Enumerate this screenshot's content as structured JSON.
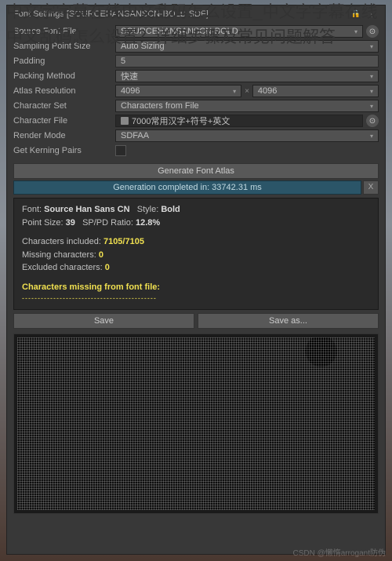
{
  "overlay": {
    "title": "中文字字幕在线中文乱码怎么设置_中文字字幕在线中文乱码怎么设置？详细步骤及常见问题解答"
  },
  "panel": {
    "title": "Font Settings [SOURCEHANSANSCN-BOLD SDF]"
  },
  "fields": {
    "sourceFontFile": {
      "label": "Source Font File",
      "value": "SOURCEHANSANSCN-BOLD"
    },
    "samplingPointSize": {
      "label": "Sampling Point Size",
      "value": "Auto Sizing"
    },
    "padding": {
      "label": "Padding",
      "value": "5"
    },
    "packingMethod": {
      "label": "Packing Method",
      "value": "快速"
    },
    "atlasResolution": {
      "label": "Atlas Resolution",
      "w": "4096",
      "h": "4096"
    },
    "characterSet": {
      "label": "Character Set",
      "value": "Characters from File"
    },
    "characterFile": {
      "label": "Character File",
      "value": "7000常用汉字+符号+英文"
    },
    "renderMode": {
      "label": "Render Mode",
      "value": "SDFAA"
    },
    "getKerningPairs": {
      "label": "Get Kerning Pairs"
    }
  },
  "buttons": {
    "generate": "Generate Font Atlas",
    "save": "Save",
    "saveAs": "Save as...",
    "close": "X"
  },
  "status": {
    "message": "Generation completed in: 33742.31 ms"
  },
  "info": {
    "fontLabel": "Font:",
    "fontName": "Source Han Sans CN",
    "styleLabel": "Style:",
    "styleName": "Bold",
    "pointSize": "Point Size:",
    "pointSizeVal": "39",
    "spRatio": "SP/PD Ratio:",
    "spRatioVal": "12.8%",
    "included": "Characters included:",
    "includedVal": "7105/7105",
    "missing": "Missing characters:",
    "missingVal": "0",
    "excluded": "Excluded characters:",
    "excludedVal": "0",
    "missingHeader": "Characters missing from font file:"
  },
  "watermark": "CSDN @懒惰arrogant防伪"
}
